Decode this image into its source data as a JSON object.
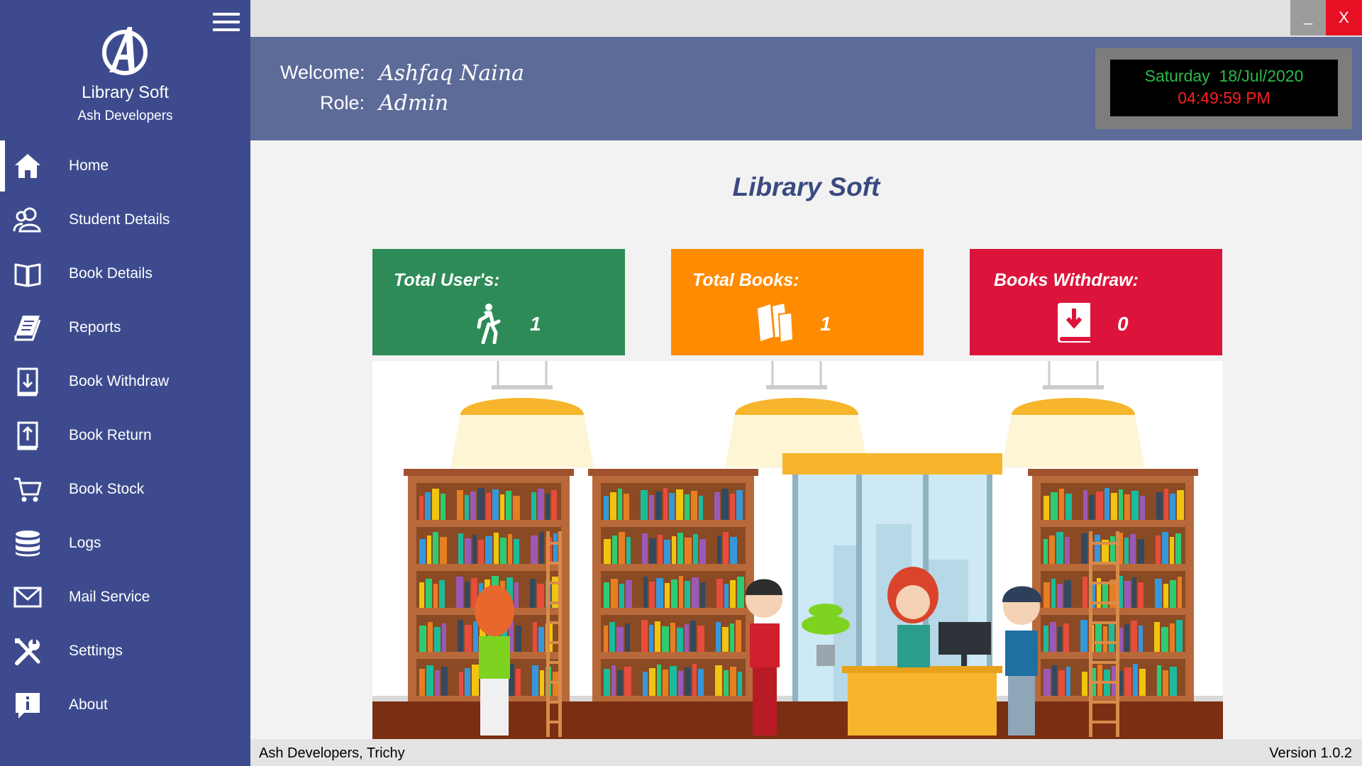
{
  "app": {
    "name": "Library Soft",
    "company": "Ash Developers"
  },
  "window": {
    "minimize_label": "_",
    "close_label": "X"
  },
  "sidebar": {
    "items": [
      {
        "label": "Home",
        "icon": "home-icon",
        "active": true
      },
      {
        "label": "Student Details",
        "icon": "users-icon"
      },
      {
        "label": "Book Details",
        "icon": "open-book-icon"
      },
      {
        "label": "Reports",
        "icon": "report-icon"
      },
      {
        "label": "Book Withdraw",
        "icon": "book-withdraw-icon"
      },
      {
        "label": "Book Return",
        "icon": "book-return-icon"
      },
      {
        "label": "Book Stock",
        "icon": "cart-icon"
      },
      {
        "label": "Logs",
        "icon": "database-icon"
      },
      {
        "label": "Mail Service",
        "icon": "mail-icon"
      },
      {
        "label": "Settings",
        "icon": "tools-icon"
      },
      {
        "label": "About",
        "icon": "info-icon"
      }
    ]
  },
  "header": {
    "welcome_label": "Welcome:",
    "welcome_value": "Ashfaq Naina",
    "role_label": "Role:",
    "role_value": "Admin",
    "clock": {
      "date": "Saturday  18/Jul/2020",
      "time": "04:49:59 PM"
    }
  },
  "main": {
    "title": "Library Soft",
    "cards": [
      {
        "title": "Total User's:",
        "value": "1",
        "color": "#2e8b57",
        "icon": "walking-person-icon"
      },
      {
        "title": "Total Books:",
        "value": "1",
        "color": "#ff8c00",
        "icon": "books-icon"
      },
      {
        "title": "Books Withdraw:",
        "value": "0",
        "color": "#dc143c",
        "icon": "book-download-icon"
      }
    ]
  },
  "footer": {
    "left": "Ash Developers, Trichy",
    "right": "Version 1.0.2"
  },
  "colors": {
    "sidebar_bg": "#3d4b8e",
    "header_bg": "#5d6b99",
    "close_button": "#e81123",
    "title_color": "#3a4a80"
  }
}
